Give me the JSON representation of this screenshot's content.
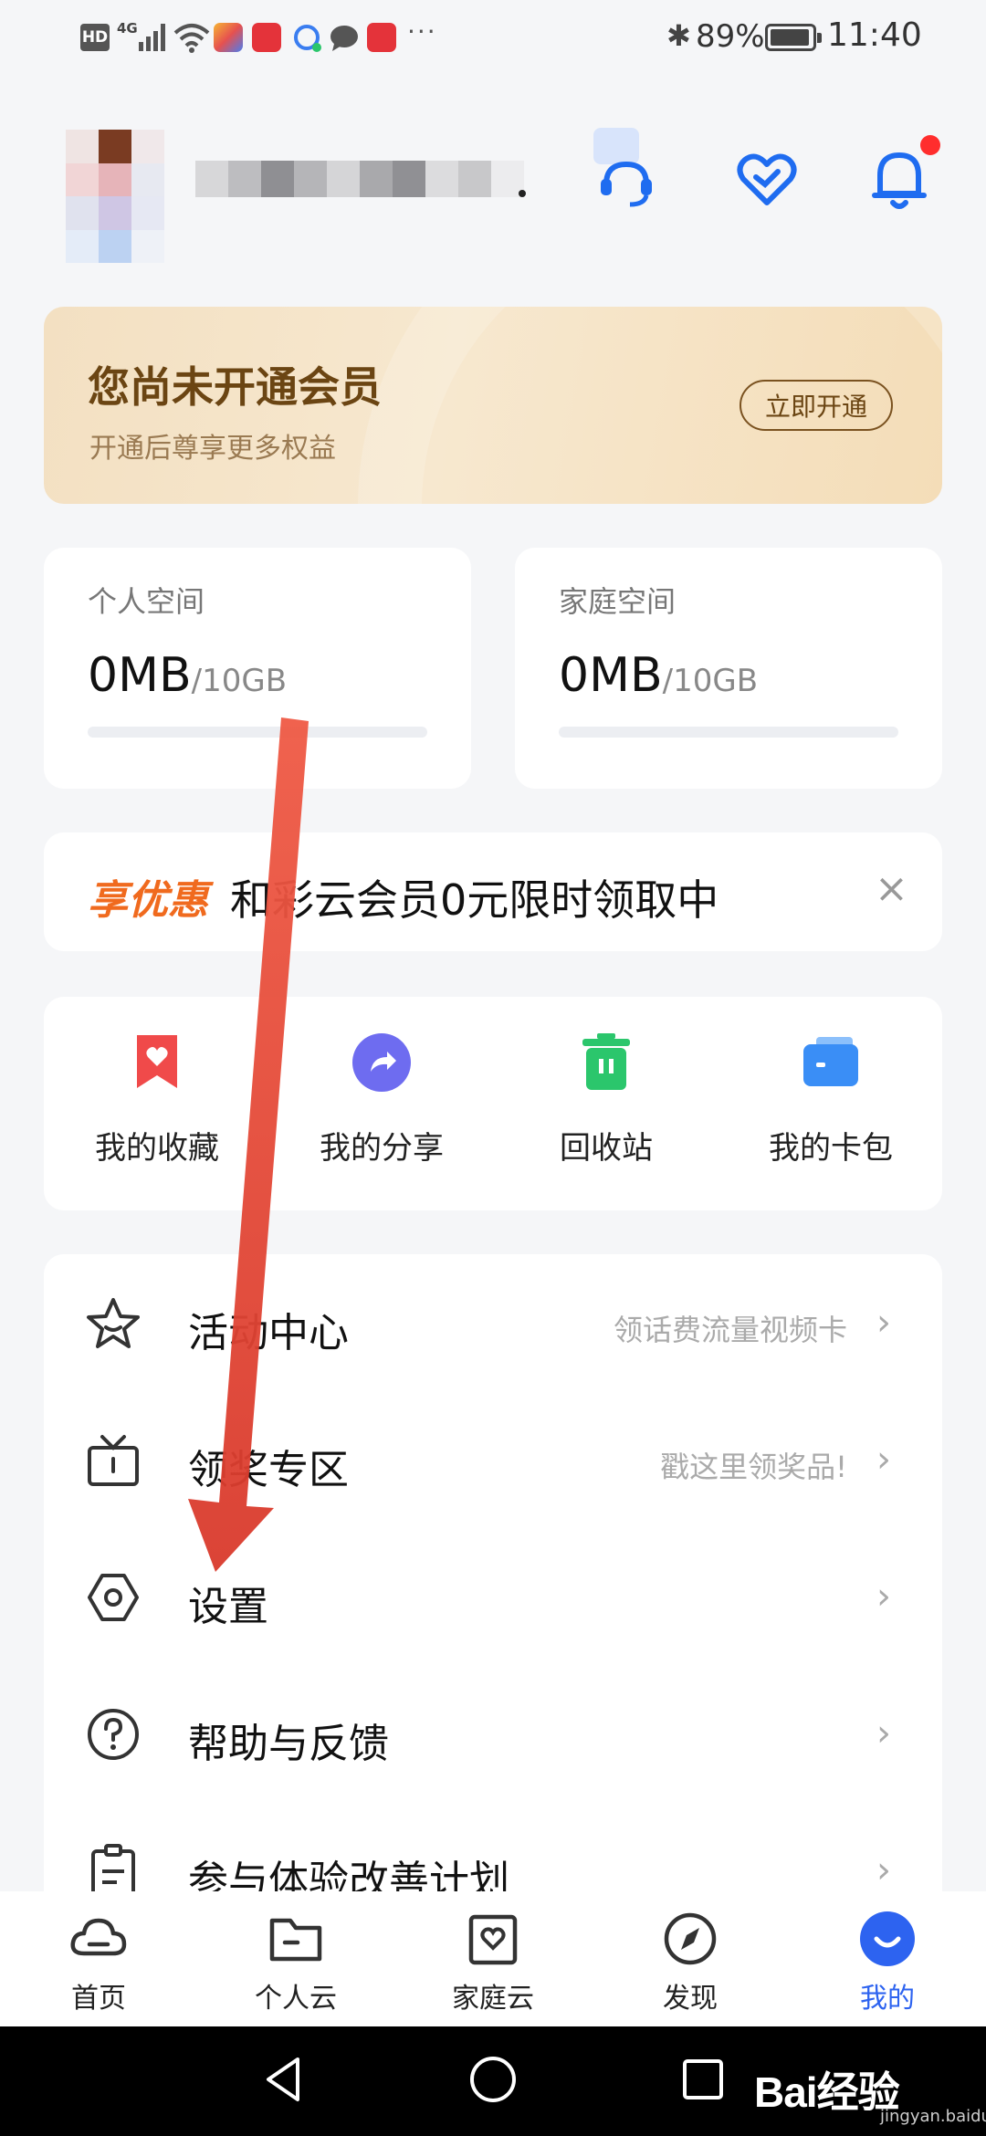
{
  "status_bar": {
    "hd_badge": "HD",
    "network": "4G",
    "overflow": "···",
    "battery": "89%",
    "time": "11:40",
    "icons": [
      "hd-icon",
      "signal-icon",
      "wifi-icon",
      "app-icon",
      "huawei-app-icon",
      "chat-app-icon",
      "message-icon",
      "reader-app-icon",
      "bluetooth-icon",
      "battery-icon"
    ]
  },
  "header": {
    "icons": [
      "customer-service-icon",
      "heart-icon",
      "bell-icon"
    ],
    "notification_dot_color": "#ff2d2d"
  },
  "member_banner": {
    "title": "您尚未开通会员",
    "subtitle": "开通后尊享更多权益",
    "button": "立即开通"
  },
  "storage": {
    "personal": {
      "label": "个人空间",
      "used": "0MB",
      "total": "/10GB",
      "usage_fraction": 0
    },
    "family": {
      "label": "家庭空间",
      "used": "0MB",
      "total": "/10GB",
      "usage_fraction": 0
    }
  },
  "promo": {
    "tag": "享优惠",
    "text": "和彩云会员0元限时领取中",
    "close": "×"
  },
  "quick_actions": [
    {
      "label": "我的收藏",
      "icon": "favorites-icon",
      "color": "#f04a4a"
    },
    {
      "label": "我的分享",
      "icon": "share-icon",
      "color": "#6e6cf0"
    },
    {
      "label": "回收站",
      "icon": "trash-icon",
      "color": "#2bc66c"
    },
    {
      "label": "我的卡包",
      "icon": "wallet-icon",
      "color": "#3a8ef6"
    }
  ],
  "menu": [
    {
      "label": "活动中心",
      "hint": "领话费流量视频卡",
      "icon": "star-icon"
    },
    {
      "label": "领奖专区",
      "hint": "戳这里领奖品!",
      "icon": "tv-gift-icon"
    },
    {
      "label": "设置",
      "hint": "",
      "icon": "settings-icon"
    },
    {
      "label": "帮助与反馈",
      "hint": "",
      "icon": "help-icon"
    },
    {
      "label": "参与体验改善计划",
      "hint": "",
      "icon": "clipboard-icon"
    }
  ],
  "chevron": "›",
  "tabbar": [
    {
      "label": "首页",
      "icon": "cloud-icon",
      "active": false
    },
    {
      "label": "个人云",
      "icon": "folder-icon",
      "active": false
    },
    {
      "label": "家庭云",
      "icon": "family-cloud-icon",
      "active": false
    },
    {
      "label": "发现",
      "icon": "compass-icon",
      "active": false
    },
    {
      "label": "我的",
      "icon": "profile-icon",
      "active": true
    }
  ],
  "accent_color": "#2d63f0",
  "watermark": {
    "text": "Bai经验",
    "sub": "jingyan.baidu.com"
  }
}
